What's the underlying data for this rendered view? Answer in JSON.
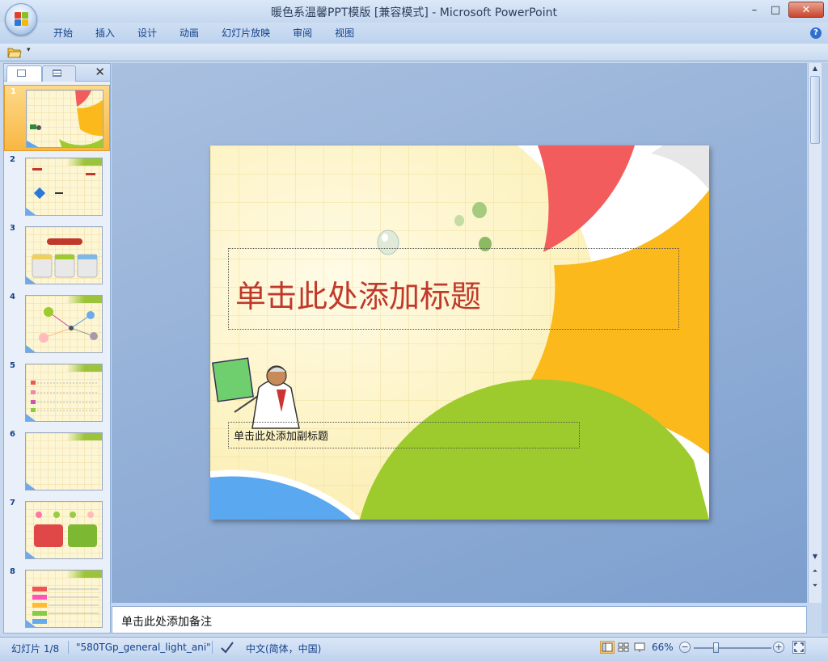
{
  "window": {
    "title": "暖色系温馨PPT模版 [兼容模式] - Microsoft PowerPoint",
    "min_label": "–",
    "max_label": "□",
    "close_label": "✕"
  },
  "ribbon": {
    "tabs": [
      "开始",
      "插入",
      "设计",
      "动画",
      "幻灯片放映",
      "审阅",
      "视图"
    ],
    "help_label": "?"
  },
  "qat": {
    "dropdown_label": "▾"
  },
  "left_pane": {
    "close_label": "✕",
    "thumbnails": [
      {
        "num": "1",
        "selected": true
      },
      {
        "num": "2",
        "selected": false
      },
      {
        "num": "3",
        "selected": false
      },
      {
        "num": "4",
        "selected": false
      },
      {
        "num": "5",
        "selected": false
      },
      {
        "num": "6",
        "selected": false
      },
      {
        "num": "7",
        "selected": false
      },
      {
        "num": "8",
        "selected": false
      }
    ]
  },
  "slide": {
    "title_placeholder": "单击此处添加标题",
    "subtitle_placeholder": "单击此处添加副标题"
  },
  "notes": {
    "placeholder": "单击此处添加备注"
  },
  "status": {
    "slide_count": "幻灯片 1/8",
    "theme": "\"580TGp_general_light_ani\"",
    "language": "中文(简体，中国)",
    "zoom": "66%",
    "zoom_out": "−",
    "zoom_in": "+"
  },
  "colors": {
    "accent_red": "#f25c5c",
    "accent_orange": "#fbb91c",
    "accent_green": "#9dca2c",
    "accent_blue": "#5aa8f0",
    "title_red": "#c0392b"
  }
}
